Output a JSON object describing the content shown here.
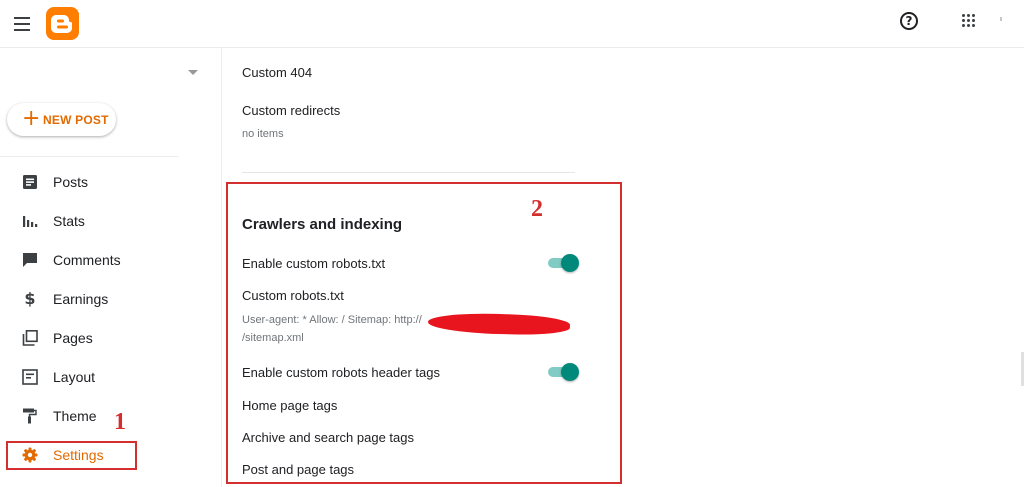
{
  "colors": {
    "brand": "#ff7e00",
    "accent": "#e36a00",
    "toggle_on": "#00897b",
    "annotation": "#d32f2f"
  },
  "topbar": {
    "menu_icon": "hamburger-menu-icon",
    "logo_icon": "blogger-logo-icon",
    "help_glyph": "?",
    "help_icon": "help-circle-icon",
    "apps_icon": "apps-grid-icon"
  },
  "sidebar": {
    "new_post_plus": "+",
    "new_post_label": "NEW POST",
    "items": [
      {
        "label": "Posts",
        "icon": "posts-icon"
      },
      {
        "label": "Stats",
        "icon": "stats-icon"
      },
      {
        "label": "Comments",
        "icon": "comments-icon"
      },
      {
        "label": "Earnings",
        "icon": "dollar-icon"
      },
      {
        "label": "Pages",
        "icon": "pages-icon"
      },
      {
        "label": "Layout",
        "icon": "layout-icon"
      },
      {
        "label": "Theme",
        "icon": "paint-roller-icon"
      },
      {
        "label": "Settings",
        "icon": "gear-icon",
        "active": true
      }
    ]
  },
  "main": {
    "custom_404": "Custom 404",
    "custom_redirects": "Custom redirects",
    "redirects_value": "no items",
    "crawlers": {
      "title": "Crawlers and indexing",
      "enable_robots_txt": {
        "label": "Enable custom robots.txt",
        "enabled": true
      },
      "custom_robots_txt": {
        "label": "Custom robots.txt",
        "value_line1": "User-agent: * Allow: / Sitemap: http://",
        "value_line2": "/sitemap.xml"
      },
      "enable_header_tags": {
        "label": "Enable custom robots header tags",
        "enabled": true
      },
      "home_page_tags": "Home page tags",
      "archive_search_tags": "Archive and search page tags",
      "post_page_tags": "Post and page tags"
    }
  },
  "annotations": {
    "marker_1": "1",
    "marker_2": "2"
  }
}
